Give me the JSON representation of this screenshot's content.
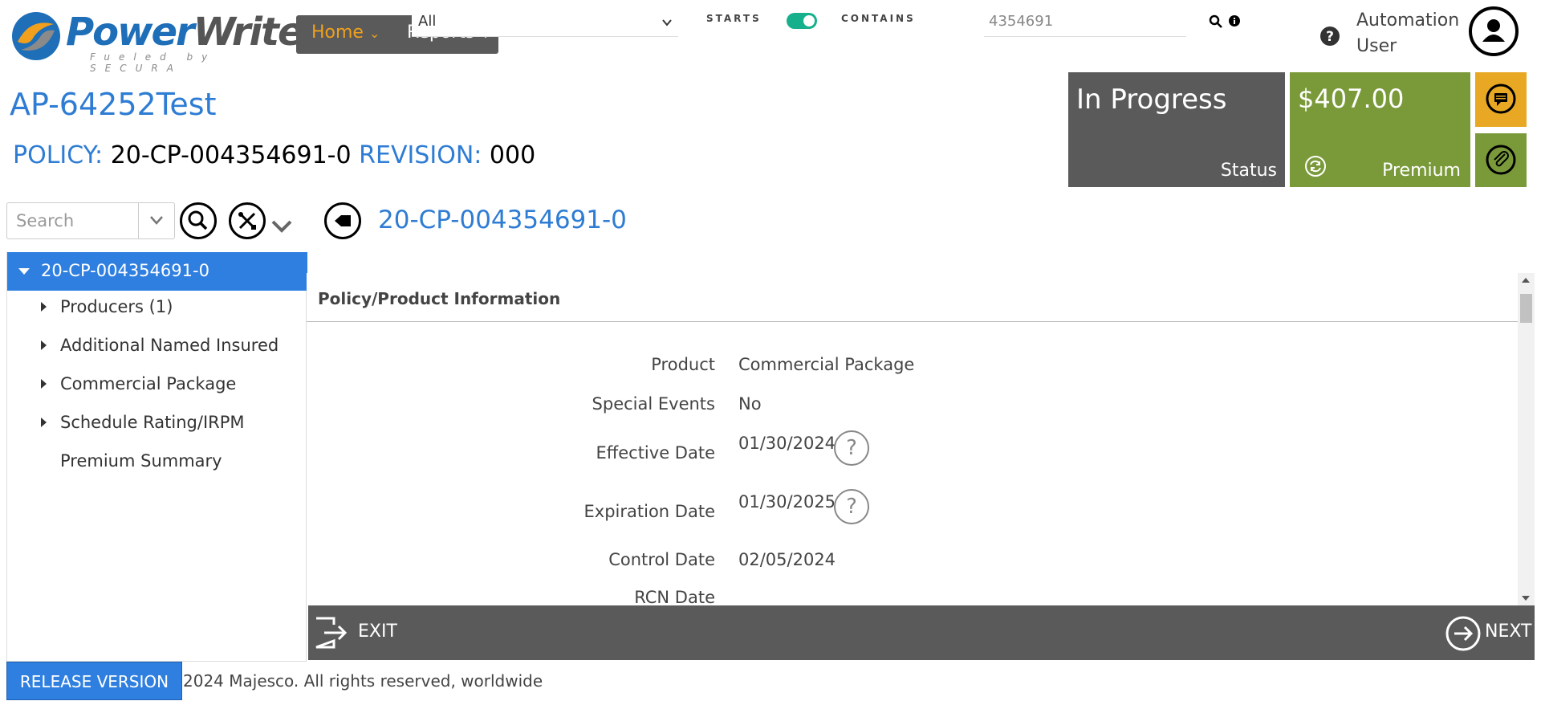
{
  "header": {
    "logo_title_a": "Power",
    "logo_title_b": "Writer",
    "logo_subtitle": "Fueled by SECURA",
    "nav_home": "Home",
    "nav_reports": "Reports",
    "filter_value": "All",
    "starts_label": "STARTS",
    "contains_label": "CONTAINS",
    "search_value": "4354691",
    "user_name": "Automation User"
  },
  "quote": {
    "title": "AP-64252Test",
    "policy_label": "POLICY:",
    "policy_number": "20-CP-004354691-0",
    "revision_label": "REVISION:",
    "revision_number": "000"
  },
  "tiles": {
    "status_value": "In Progress",
    "status_label": "Status",
    "premium_value": "$407.00",
    "premium_label": "Premium"
  },
  "tree": {
    "search_placeholder": "Search",
    "heading": "20-CP-004354691-0",
    "root": "20-CP-004354691-0",
    "items": [
      {
        "label": "Producers (1)"
      },
      {
        "label": "Additional Named Insured"
      },
      {
        "label": "Commercial Package"
      },
      {
        "label": "Schedule Rating/IRPM"
      },
      {
        "label": "Premium Summary"
      }
    ]
  },
  "content": {
    "section_title": "Policy/Product Information",
    "fields": [
      {
        "label": "Product",
        "value": "Commercial Package"
      },
      {
        "label": "Special Events",
        "value": "No"
      },
      {
        "label": "Effective Date",
        "value": "01/30/2024"
      },
      {
        "label": "Expiration Date",
        "value": "01/30/2025"
      },
      {
        "label": "Control Date",
        "value": "02/05/2024"
      },
      {
        "label": "RCN Date",
        "value": ""
      }
    ]
  },
  "footer": {
    "exit_label": "EXIT",
    "next_label": "NEXT",
    "release_label": "RELEASE VERSION",
    "copyright": "2024 Majesco. All rights reserved, worldwide"
  },
  "colors": {
    "accent_blue": "#2e7cd3",
    "status_tile": "#5a5a5a",
    "premium_tile": "#7a9a3a",
    "message_tile": "#e8a823",
    "toggle_on": "#16b08c",
    "nav_home": "#f0a01c"
  }
}
